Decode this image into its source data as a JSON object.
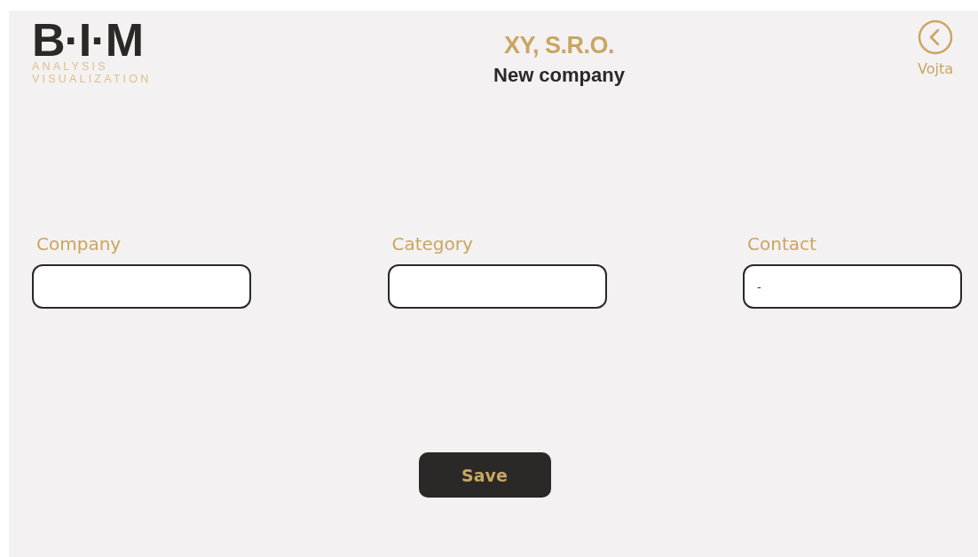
{
  "logo": {
    "mark": "B·I·M",
    "line_1": "ANALYSIS",
    "line_2": "VISUALIZATION"
  },
  "header": {
    "company": "XY, S.R.O.",
    "title": "New company"
  },
  "user": {
    "name": "Vojta"
  },
  "fields": [
    {
      "label": "Company"
    },
    {
      "label": "Category"
    },
    {
      "label": "Contact",
      "value": "-"
    }
  ],
  "buttons": [
    "Save"
  ]
}
